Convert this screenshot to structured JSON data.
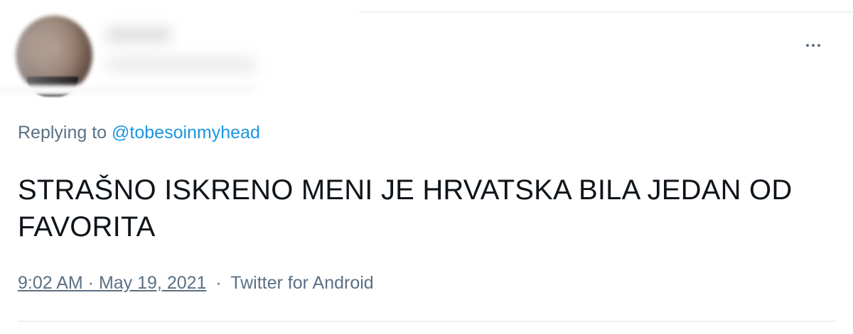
{
  "tweet": {
    "more_label": "More",
    "replying_prefix": "Replying to",
    "replying_handle": "@tobesoinmyhead",
    "text": "STRAŠNO ISKRENO MENI JE HRVATSKA BILA JEDAN OD FAVORITA",
    "timestamp": "9:02 AM · May 19, 2021",
    "separator": "·",
    "source": "Twitter for Android"
  },
  "colors": {
    "secondary_text": "#5b7083",
    "link": "#1b95e0",
    "primary_text": "#0f1419",
    "divider": "#eef1f3"
  }
}
